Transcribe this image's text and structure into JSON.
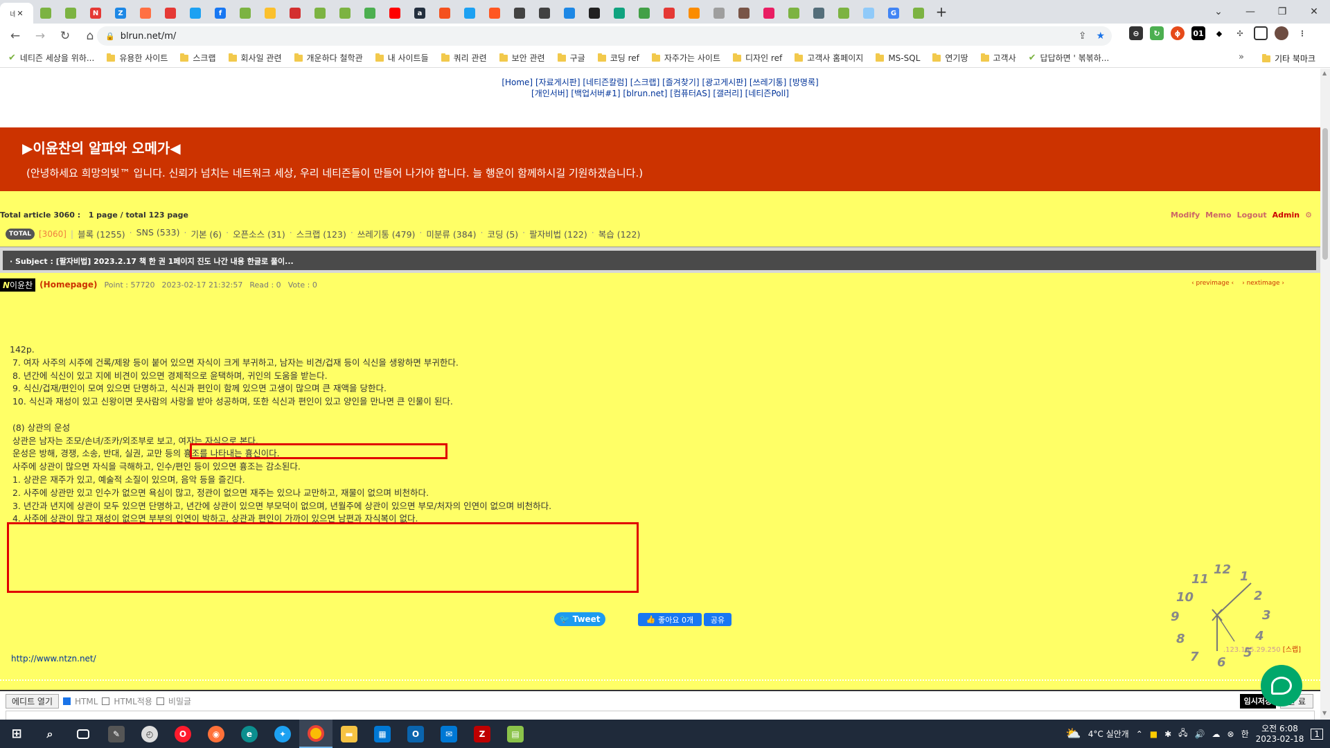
{
  "browser": {
    "active_tab_label": "네",
    "tabs": [
      {
        "letter": "",
        "color": "#7cb342"
      },
      {
        "letter": "",
        "color": "#7cb342"
      },
      {
        "letter": "N",
        "color": "#e53935"
      },
      {
        "letter": "Z",
        "color": "#1e88e5"
      },
      {
        "letter": "",
        "color": "#ff7043"
      },
      {
        "letter": "",
        "color": "#e53935"
      },
      {
        "letter": "",
        "color": "#1da1f2"
      },
      {
        "letter": "f",
        "color": "#1877f2"
      },
      {
        "letter": "",
        "color": "#7cb342"
      },
      {
        "letter": "",
        "color": "#fbc02d"
      },
      {
        "letter": "",
        "color": "#d32f2f"
      },
      {
        "letter": "",
        "color": "#7cb342"
      },
      {
        "letter": "",
        "color": "#7cb342"
      },
      {
        "letter": "",
        "color": "#4caf50"
      },
      {
        "letter": "",
        "color": "#ff0000"
      },
      {
        "letter": "a",
        "color": "#232f3e"
      },
      {
        "letter": "",
        "color": "#f4511e"
      },
      {
        "letter": "",
        "color": "#1da1f2"
      },
      {
        "letter": "",
        "color": "#ff5722"
      },
      {
        "letter": "",
        "color": "#424242"
      },
      {
        "letter": "",
        "color": "#424242"
      },
      {
        "letter": "",
        "color": "#1e88e5"
      },
      {
        "letter": "",
        "color": "#212121"
      },
      {
        "letter": "",
        "color": "#10a37f"
      },
      {
        "letter": "",
        "color": "#43a047"
      },
      {
        "letter": "",
        "color": "#e53935"
      },
      {
        "letter": "",
        "color": "#fb8c00"
      },
      {
        "letter": "",
        "color": "#9e9e9e"
      },
      {
        "letter": "",
        "color": "#795548"
      },
      {
        "letter": "",
        "color": "#e91e63"
      },
      {
        "letter": "",
        "color": "#7cb342"
      },
      {
        "letter": "",
        "color": "#546e7a"
      },
      {
        "letter": "",
        "color": "#7cb342"
      },
      {
        "letter": "",
        "color": "#90caf9"
      },
      {
        "letter": "G",
        "color": "#4285f4"
      },
      {
        "letter": "",
        "color": "#7cb342"
      }
    ],
    "url": "blrun.net/m/",
    "bookmarks": [
      {
        "label": "네티즌 세상을 위하...",
        "type": "leaf"
      },
      {
        "label": "유용한 사이트",
        "type": "folder"
      },
      {
        "label": "스크랩",
        "type": "folder"
      },
      {
        "label": "회사일 관련",
        "type": "folder"
      },
      {
        "label": "개운하다 철학관",
        "type": "folder"
      },
      {
        "label": "내 사이트들",
        "type": "folder"
      },
      {
        "label": "쿼리 관련",
        "type": "folder"
      },
      {
        "label": "보안 관련",
        "type": "folder"
      },
      {
        "label": "구글",
        "type": "folder"
      },
      {
        "label": "코딩 ref",
        "type": "folder"
      },
      {
        "label": "자주가는 사이트",
        "type": "folder"
      },
      {
        "label": "디자인 ref",
        "type": "folder"
      },
      {
        "label": "고객사 홈페이지",
        "type": "folder"
      },
      {
        "label": "MS-SQL",
        "type": "folder"
      },
      {
        "label": "연기땅",
        "type": "folder"
      },
      {
        "label": "고객사",
        "type": "folder"
      },
      {
        "label": "답답하면 ' 볶볶하...",
        "type": "leaf"
      }
    ],
    "bookmarks_more": "»",
    "other_bookmarks": "기타 북마크"
  },
  "site": {
    "nav_line1": [
      "[Home]",
      "[자료게시판]",
      "[네티즌칼럼]",
      "[스크랩]",
      "[즐겨찾기]",
      "[광고게시판]",
      "[쓰레기통]",
      "[방명록]"
    ],
    "nav_line2": [
      "[개인서버]",
      "[백업서버#1]",
      "[blrun.net]",
      "[컴퓨터AS]",
      "[갤러리]",
      "[네티즌Poll]"
    ],
    "banner_title": "▶이윤찬의 알파와 오메가◀",
    "banner_sub": "(안녕하세요 희망의빛™ 입니다. 신뢰가 넘치는 네트워크 세상, 우리 네티즌들이 만들어 나가야 합니다. 늘 행운이 함께하시길 기원하겠습니다.)",
    "stats_total": "Total article 3060 :",
    "stats_page": "1 page / total 123 page",
    "admin_links": [
      "Modify",
      "Memo",
      "Logout"
    ],
    "admin_label": "Admin",
    "total_badge": "TOTAL",
    "total_count": "[3060]",
    "categories": [
      "블록 (1255)",
      "SNS (533)",
      "기본 (6)",
      "오픈소스 (31)",
      "스크랩 (123)",
      "쓰레기통 (479)",
      "미분류 (384)",
      "코딩 (5)",
      "팔자비법 (122)",
      "복습 (122)"
    ],
    "subject": "· Subject : [팔자비법] 2023.2.17 책 한 권 1페이지 진도 나간 내용 한글로 풀이...",
    "author_badge_n": "N",
    "author_name": "이윤찬",
    "homepage": "(Homepage)",
    "point": "Point : 57720",
    "date": "2023-02-17 21:32:57",
    "read": "Read : 0",
    "vote": "Vote : 0",
    "prev": "‹ previmage ‹",
    "next": "› nextimage ›",
    "content_lines": [
      "142p.",
      " 7. 여자 사주의 시주에 건록/제왕 등이 붙어 있으면 자식이 크게 부귀하고, 남자는 비견/겁재 등이 식신을 생왕하면 부귀한다.",
      " 8. 년간에 식신이 있고 지에 비견이 있으면 경제적으로 윤택하며, 귀인의 도움을 받는다.",
      " 9. 식신/겁재/편인이 모여 있으면 단명하고, 식신과 편인이 함께 있으면 고생이 많으며 큰 재액을 당한다.",
      " 10. 식신과 재성이 있고 신왕이면 뭇사람의 사랑을 받아 성공하며, 또한 식신과 편인이 있고 양인을 만나면 큰 인물이 된다.",
      "",
      " (8) 상관의 운성",
      " 상관은 남자는 조모/손녀/조카/외조부로 보고, 여자는 자식으로 본다.",
      " 운성은 방해, 경쟁, 소송, 반대, 실권, 교만 등의 흉조를 나타내는 흉신이다.",
      " 사주에 상관이 많으면 자식을 극해하고, 인수/편인 등이 있으면 흉조는 감소된다.",
      " 1. 상관은 재주가 있고, 예술적 소질이 있으며, 음악 등을 즐긴다.",
      " 2. 사주에 상관만 있고 인수가 없으면 욕심이 많고, 정관이 없으면 재주는 있으나 교만하고, 재물이 없으며 비천하다.",
      " 3. 년간과 년지에 상관이 모두 있으면 단명하고, 년간에 상관이 있으면 부모덕이 없으며, 년월주에 상관이 있으면 부모/처자의 인연이 없으며 비천하다.",
      " 4. 사주에 상관이 많고 재성이 없으면 부부의 인연이 박하고, 상관과 편인이 가까이 있으면 남편과 자식복이 없다."
    ],
    "tweet": "Tweet",
    "fb_like": "좋아요 0개",
    "fb_share": "공유",
    "link_url": "http://www.ntzn.net/",
    "ip": ".123.135.29.250",
    "scrap": "[스랩]"
  },
  "editor": {
    "open_btn": "에디트 열기",
    "html_label": "HTML",
    "html_apply_label": "HTML적용",
    "secret_label": "비밀글",
    "temp_save": "임시저장",
    "done": "완 료"
  },
  "clock_numbers": [
    "12",
    "1",
    "2",
    "3",
    "4",
    "5",
    "6",
    "7",
    "8",
    "9",
    "10",
    "11"
  ],
  "taskbar": {
    "weather": "4°C 실안개",
    "time": "오전 6:08",
    "date": "2023-02-18",
    "notif": "1"
  },
  "colors": {
    "banner": "#cc3300",
    "board_bg": "#ffff66",
    "highlight": "#e00000"
  }
}
